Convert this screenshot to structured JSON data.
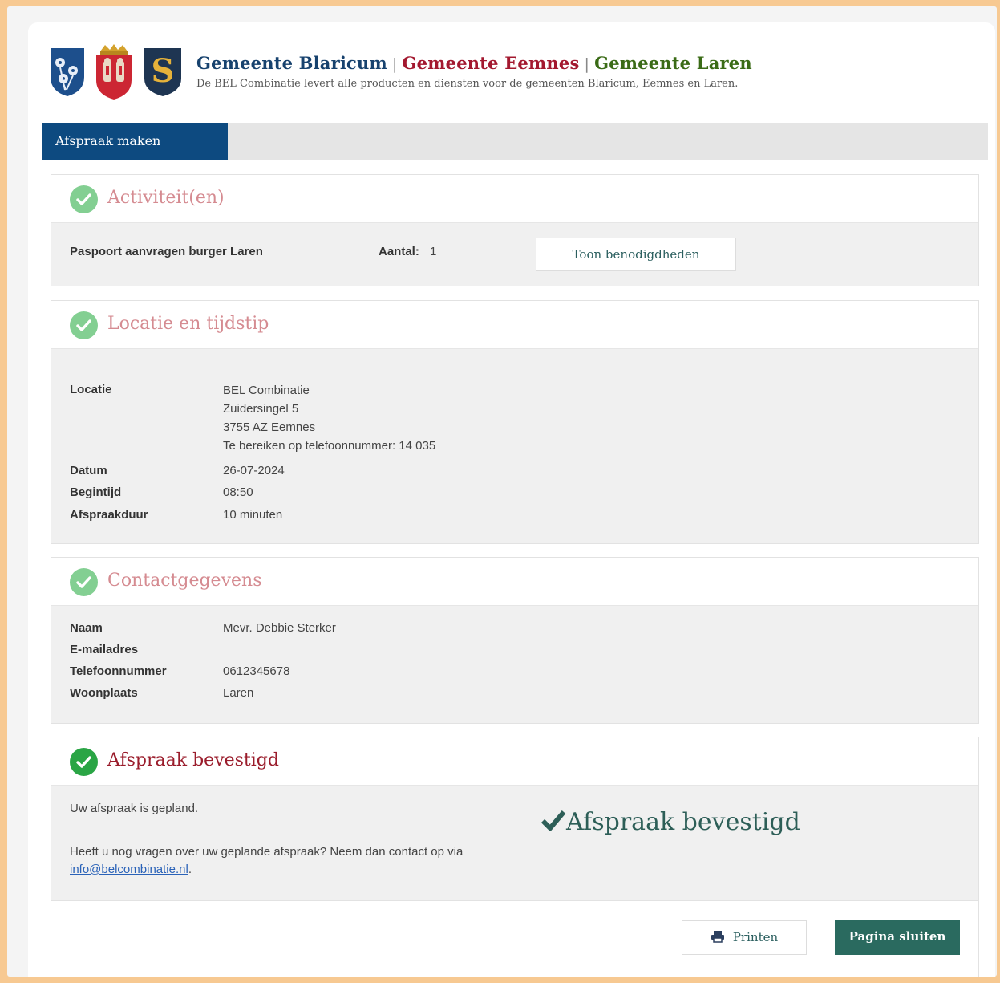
{
  "header": {
    "municipalities": [
      "Gemeente Blaricum",
      "Gemeente Eemnes",
      "Gemeente Laren"
    ],
    "separator": "|",
    "tagline": "De BEL Combinatie levert alle producten en diensten voor de gemeenten Blaricum, Eemnes en Laren.",
    "laren_logo_letter": "S"
  },
  "tabs": {
    "active_label": "Afspraak maken"
  },
  "activities": {
    "title": "Activiteit(en)",
    "item_name": "Paspoort aanvragen burger Laren",
    "count_label": "Aantal:",
    "count_value": "1",
    "show_requirements_label": "Toon benodigdheden"
  },
  "location": {
    "title": "Locatie en tijdstip",
    "location_label": "Locatie",
    "location_lines": [
      "BEL Combinatie",
      "Zuidersingel 5",
      "3755 AZ Eemnes",
      "Te bereiken op telefoonnummer: 14 035"
    ],
    "date_label": "Datum",
    "date_value": "26-07-2024",
    "start_label": "Begintijd",
    "start_value": "08:50",
    "duration_label": "Afspraakduur",
    "duration_value": "10 minuten"
  },
  "contact": {
    "title": "Contactgegevens",
    "name_label": "Naam",
    "name_value": "Mevr. Debbie Sterker",
    "email_label": "E-mailadres",
    "email_value": "",
    "phone_label": "Telefoonnummer",
    "phone_value": "0612345678",
    "city_label": "Woonplaats",
    "city_value": "Laren"
  },
  "confirmation": {
    "title": "Afspraak bevestigd",
    "planned_text": "Uw afspraak is gepland.",
    "questions_text": "Heeft u nog vragen over uw geplande afspraak? Neem dan contact op via",
    "email_link": "info@belcombinatie.nl",
    "email_suffix": ".",
    "big_label": "Afspraak bevestigd"
  },
  "footer": {
    "print_label": "Printen",
    "close_label": "Pagina sluiten"
  },
  "colors": {
    "outer_border": "#f7c992",
    "primary_blue": "#0d4a80",
    "teal_button": "#2a6a5f",
    "check_light": "#83cf92",
    "check_strong": "#2aa545",
    "title_pink": "#d58b91",
    "title_red": "#9a1c2b"
  }
}
